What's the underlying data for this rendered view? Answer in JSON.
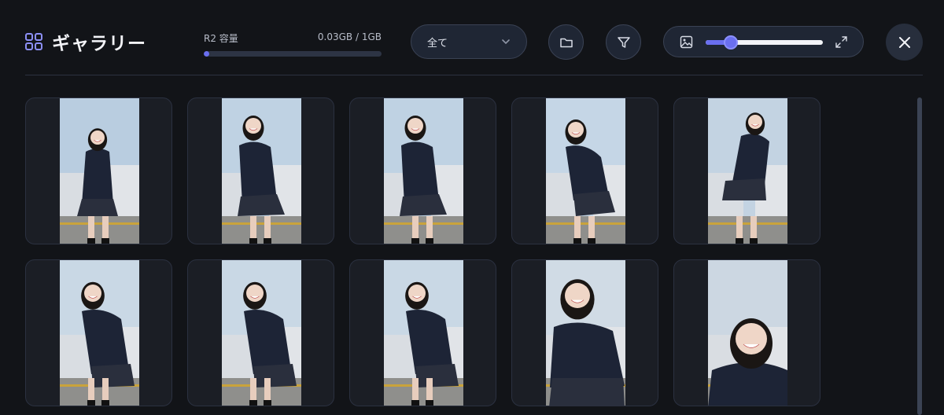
{
  "app": {
    "title": "ギャラリー"
  },
  "storage": {
    "label": "R2 容量",
    "usage": "0.03GB / 1GB",
    "percent": 3
  },
  "filter_select": {
    "value": "全て"
  },
  "zoom": {
    "level": 0.2
  },
  "icons": {
    "grid": "grid-icon",
    "chevron": "chevron-down-icon",
    "folder": "folder-icon",
    "filter": "filter-icon",
    "image": "image-icon",
    "expand": "expand-icon",
    "close": "close-icon"
  },
  "colors": {
    "accent": "#6a6ff0",
    "background": "#121418",
    "tile": "#1b1e25"
  },
  "gallery": {
    "items": [
      {
        "pose": "standing-front"
      },
      {
        "pose": "laughing-lean"
      },
      {
        "pose": "laughing-lean"
      },
      {
        "pose": "lean-forward"
      },
      {
        "pose": "squat-side"
      },
      {
        "pose": "bow-laugh"
      },
      {
        "pose": "bow-laugh"
      },
      {
        "pose": "bow-laugh"
      },
      {
        "pose": "crouch-close"
      },
      {
        "pose": "portrait-close"
      }
    ]
  }
}
